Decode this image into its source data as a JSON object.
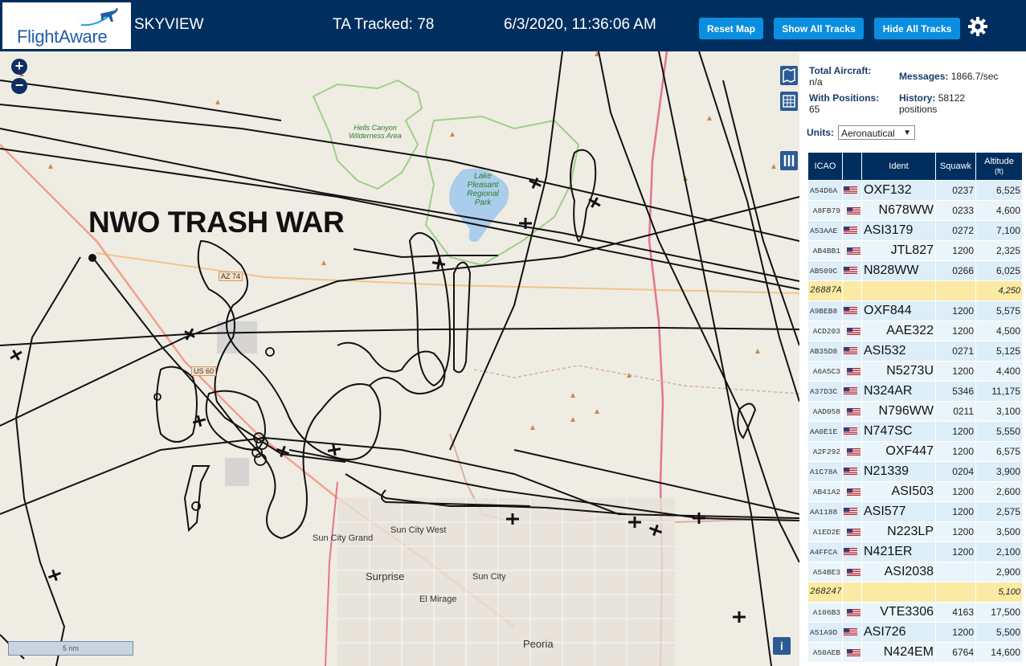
{
  "header": {
    "logo_text": "FlightAware",
    "app_title": "SKYVIEW",
    "tracked": "TA Tracked: 78",
    "datetime": "6/3/2020, 11:36:06 AM",
    "buttons": {
      "reset": "Reset Map",
      "show_all": "Show All Tracks",
      "hide_all": "Hide All Tracks"
    },
    "gear_icon": "gear-icon",
    "colors": {
      "bar": "#002f5f",
      "button": "#0a8ee0"
    }
  },
  "map": {
    "overlay_text": "NWO TRASH WAR",
    "scale_label": "5 nm",
    "zoom_in": "+",
    "zoom_out": "−",
    "info": "i",
    "labels": {
      "hells_canyon": "Hells Canyon Wilderness Area",
      "lake_pleasant": "Lake Pleasant Regional Park",
      "az74": "AZ 74",
      "us60": "US 60",
      "sun_city_grand": "Sun City Grand",
      "sun_city_west": "Sun City West",
      "surprise": "Surprise",
      "sun_city": "Sun City",
      "el_mirage": "El Mirage",
      "peoria": "Peoria"
    }
  },
  "panel": {
    "total_aircraft_label": "Total Aircraft:",
    "total_aircraft_value": "n/a",
    "with_positions_label": "With Positions:",
    "with_positions_value": "65",
    "messages_label": "Messages:",
    "messages_value": "1866.7/sec",
    "history_label": "History:",
    "history_value": "58122",
    "history_unit": "positions",
    "units_label": "Units:",
    "units_value": "Aeronautical",
    "columns": {
      "icao": "ICAO",
      "ident": "Ident",
      "squawk": "Squawk",
      "altitude": "Altitude",
      "altitude_unit": "(ft)"
    },
    "rows": [
      {
        "icao": "A54D6A",
        "ident": "OXF132",
        "squawk": "0237",
        "alt": "6,525"
      },
      {
        "icao": "A8FB79",
        "ident": "N678WW",
        "squawk": "0233",
        "alt": "4,600"
      },
      {
        "icao": "A53AAE",
        "ident": "ASI3179",
        "squawk": "0272",
        "alt": "7,100"
      },
      {
        "icao": "AB4BB1",
        "ident": "JTL827",
        "squawk": "1200",
        "alt": "2,325"
      },
      {
        "icao": "AB509C",
        "ident": "N828WW",
        "squawk": "0266",
        "alt": "6,025"
      },
      {
        "icao": "26887A",
        "ident": "",
        "squawk": "",
        "alt": "4,250",
        "nf": true
      },
      {
        "icao": "A9BEB8",
        "ident": "OXF844",
        "squawk": "1200",
        "alt": "5,575"
      },
      {
        "icao": "ACD203",
        "ident": "AAE322",
        "squawk": "1200",
        "alt": "4,500"
      },
      {
        "icao": "AB35D8",
        "ident": "ASI532",
        "squawk": "0271",
        "alt": "5,125"
      },
      {
        "icao": "A6A5C3",
        "ident": "N5273U",
        "squawk": "1200",
        "alt": "4,400"
      },
      {
        "icao": "A37D3C",
        "ident": "N324AR",
        "squawk": "5346",
        "alt": "11,175"
      },
      {
        "icao": "AAD058",
        "ident": "N796WW",
        "squawk": "0211",
        "alt": "3,100"
      },
      {
        "icao": "AA0E1E",
        "ident": "N747SC",
        "squawk": "1200",
        "alt": "5,550"
      },
      {
        "icao": "A2F292",
        "ident": "OXF447",
        "squawk": "1200",
        "alt": "6,575"
      },
      {
        "icao": "A1C78A",
        "ident": "N21339",
        "squawk": "0204",
        "alt": "3,900"
      },
      {
        "icao": "AB41A2",
        "ident": "ASI503",
        "squawk": "1200",
        "alt": "2,600"
      },
      {
        "icao": "AA1188",
        "ident": "ASI577",
        "squawk": "1200",
        "alt": "2,575"
      },
      {
        "icao": "A1ED2E",
        "ident": "N223LP",
        "squawk": "1200",
        "alt": "3,500"
      },
      {
        "icao": "A4FFCA",
        "ident": "N421ER",
        "squawk": "1200",
        "alt": "2,100"
      },
      {
        "icao": "A54BE3",
        "ident": "ASI2038",
        "squawk": "",
        "alt": "2,900"
      },
      {
        "icao": "268247",
        "ident": "",
        "squawk": "",
        "alt": "5,100",
        "nf": true
      },
      {
        "icao": "A106B3",
        "ident": "VTE3306",
        "squawk": "4163",
        "alt": "17,500"
      },
      {
        "icao": "A51A9D",
        "ident": "ASI726",
        "squawk": "1200",
        "alt": "5,500"
      },
      {
        "icao": "A50AEB",
        "ident": "N424EM",
        "squawk": "6764",
        "alt": "14,600"
      }
    ]
  }
}
